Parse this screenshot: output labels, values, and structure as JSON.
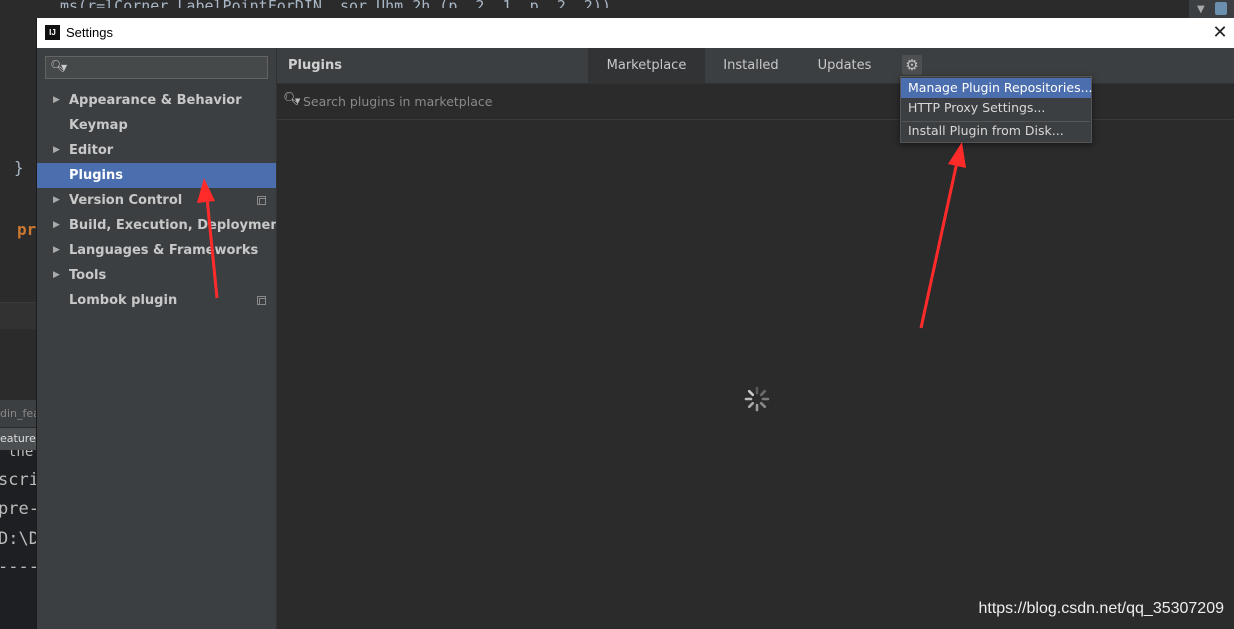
{
  "ide": {
    "top_code": "ms(r=lCorner LabelPointForDIN, sor Uhm 2h (p, 2, 1, p, 2, 2))",
    "brace": "}",
    "keyword": "pr",
    "tab1": "din_fea",
    "tab2": "eature_",
    "console": [
      "the",
      "scri",
      "pre-",
      "D:\\D",
      "----"
    ]
  },
  "dialog": {
    "icon_text": "IJ",
    "title": "Settings",
    "close": "✕"
  },
  "sidebar": {
    "items": [
      {
        "label": "Appearance & Behavior",
        "expandable": true
      },
      {
        "label": "Keymap",
        "expandable": false
      },
      {
        "label": "Editor",
        "expandable": true
      },
      {
        "label": "Plugins",
        "expandable": false,
        "selected": true
      },
      {
        "label": "Version Control",
        "expandable": true,
        "project_icon": true
      },
      {
        "label": "Build, Execution, Deployment",
        "expandable": true
      },
      {
        "label": "Languages & Frameworks",
        "expandable": true
      },
      {
        "label": "Tools",
        "expandable": true
      },
      {
        "label": "Lombok plugin",
        "expandable": false,
        "project_icon": true
      }
    ]
  },
  "main": {
    "title": "Plugins",
    "tabs": [
      {
        "label": "Marketplace",
        "active": true
      },
      {
        "label": "Installed",
        "active": false
      },
      {
        "label": "Updates",
        "active": false
      }
    ],
    "search_placeholder": "Search plugins in marketplace"
  },
  "gear_menu": {
    "items": [
      {
        "label": "Manage Plugin Repositories...",
        "selected": true
      },
      {
        "label": "HTTP Proxy Settings...",
        "selected": false
      },
      {
        "label": "Install Plugin from Disk...",
        "selected": false
      }
    ]
  },
  "watermark": "https://blog.csdn.net/qq_35307209",
  "colors": {
    "selection": "#4b6eaf",
    "annotation_arrow": "#ff2b2b",
    "panel": "#3c3f41",
    "background": "#2b2b2b"
  }
}
